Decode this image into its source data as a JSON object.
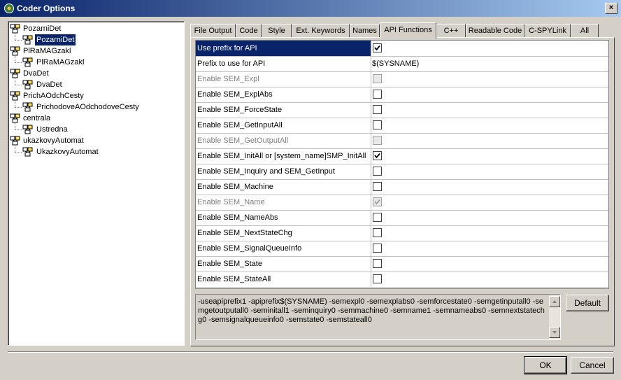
{
  "window": {
    "title": "Coder Options",
    "close_glyph": "×"
  },
  "tree": {
    "nodes": [
      {
        "label": "PozarniDet",
        "child": "PozarniDet",
        "child_selected": true
      },
      {
        "label": "PlRaMAGzakl",
        "child": "PlRaMAGzakl"
      },
      {
        "label": "DvaDet",
        "child": "DvaDet"
      },
      {
        "label": "PrichAOdchCesty",
        "child": "PrichodoveAOdchodoveCesty"
      },
      {
        "label": "centrala",
        "child": "Ustredna"
      },
      {
        "label": "ukazkovyAutomat",
        "child": "UkazkovyAutomat"
      }
    ]
  },
  "tabs": [
    {
      "label": "File Output"
    },
    {
      "label": "Code"
    },
    {
      "label": "Style"
    },
    {
      "label": "Ext. Keywords"
    },
    {
      "label": "Names"
    },
    {
      "label": "API Functions",
      "active": true
    },
    {
      "label": "C++"
    },
    {
      "label": "Readable Code"
    },
    {
      "label": "C-SPYLink"
    },
    {
      "label": "All"
    }
  ],
  "options": [
    {
      "name": "Use prefix for API",
      "type": "check",
      "checked": true,
      "selected": true
    },
    {
      "name": "Prefix to use for API",
      "type": "text",
      "value": "$(SYSNAME)"
    },
    {
      "name": "Enable SEM_Expl",
      "type": "check",
      "checked": false,
      "disabled": true
    },
    {
      "name": "Enable SEM_ExplAbs",
      "type": "check",
      "checked": false
    },
    {
      "name": "Enable SEM_ForceState",
      "type": "check",
      "checked": false
    },
    {
      "name": "Enable SEM_GetInputAll",
      "type": "check",
      "checked": false
    },
    {
      "name": "Enable SEM_GetOutputAll",
      "type": "check",
      "checked": false,
      "disabled": true
    },
    {
      "name": "Enable SEM_InitAll or [system_name]SMP_InitAll",
      "type": "check",
      "checked": true
    },
    {
      "name": "Enable SEM_Inquiry and SEM_GetInput",
      "type": "check",
      "checked": false
    },
    {
      "name": "Enable SEM_Machine",
      "type": "check",
      "checked": false
    },
    {
      "name": "Enable SEM_Name",
      "type": "check",
      "checked": true,
      "disabled": true
    },
    {
      "name": "Enable SEM_NameAbs",
      "type": "check",
      "checked": false
    },
    {
      "name": "Enable SEM_NextStateChg",
      "type": "check",
      "checked": false
    },
    {
      "name": "Enable SEM_SignalQueueInfo",
      "type": "check",
      "checked": false
    },
    {
      "name": "Enable SEM_State",
      "type": "check",
      "checked": false
    },
    {
      "name": "Enable SEM_StateAll",
      "type": "check",
      "checked": false
    }
  ],
  "command_line": "-useapiprefix1 -apiprefix$(SYSNAME) -semexpl0 -semexplabs0 -semforcestate0 -semgetinputall0 -semgetoutputall0 -seminitall1 -seminquiry0 -semmachine0 -semname1 -semnameabs0 -semnextstatechg0 -semsignalqueueinfo0 -semstate0 -semstateall0",
  "buttons": {
    "default": "Default",
    "ok": "OK",
    "cancel": "Cancel"
  },
  "icons": {
    "app": "app-icon",
    "machine": "state-machine-icon",
    "checkmark": "checkmark-icon"
  }
}
